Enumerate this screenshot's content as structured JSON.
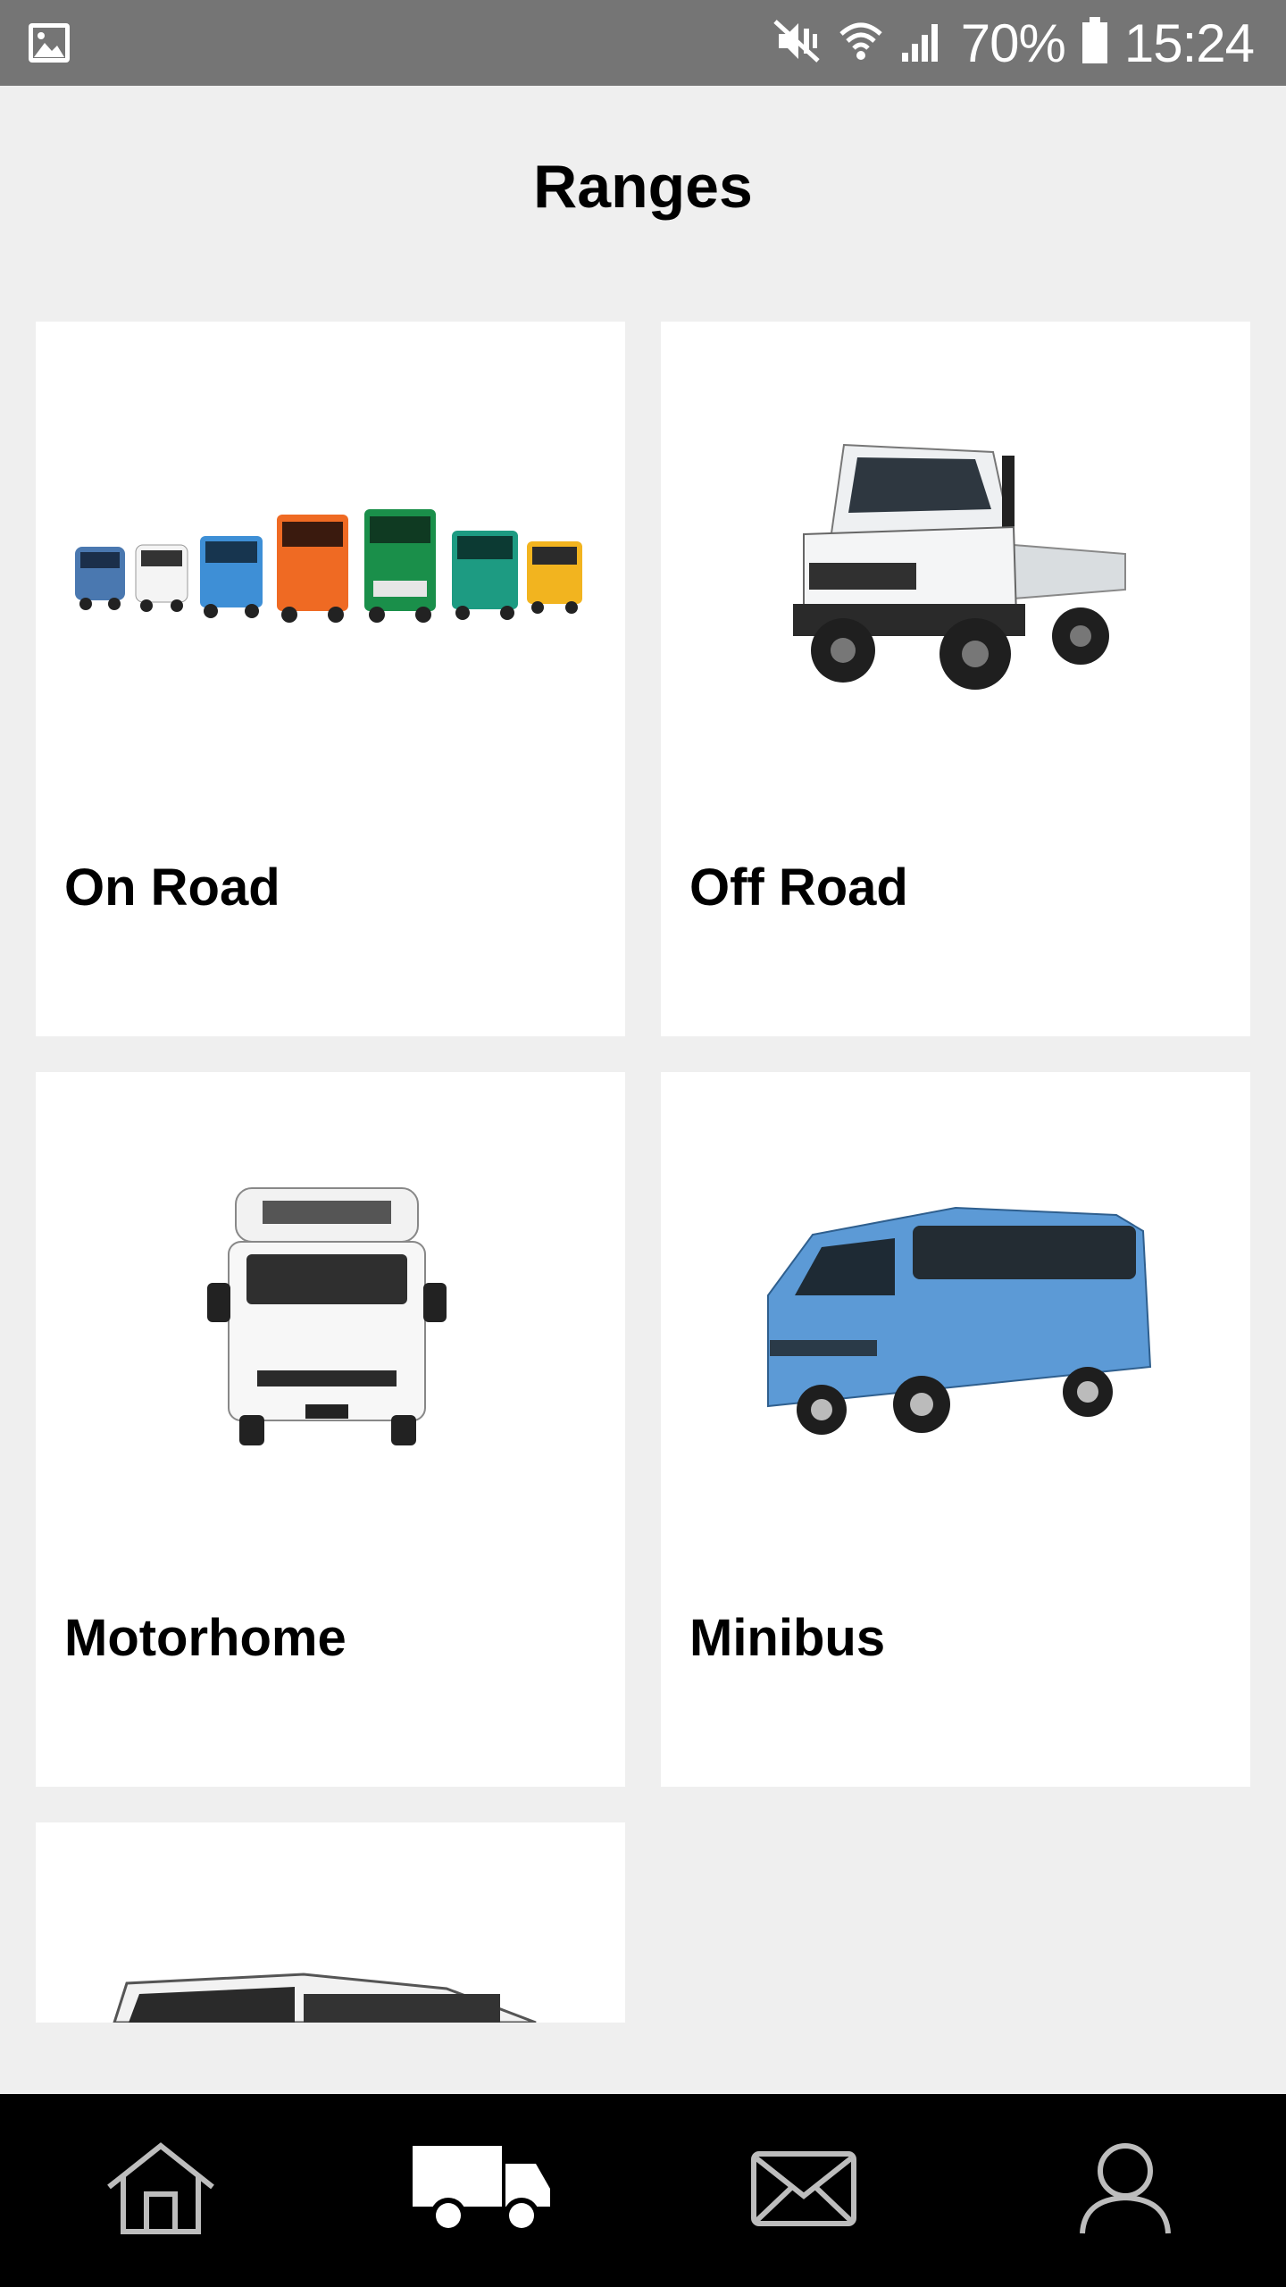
{
  "status_bar": {
    "battery_percent": "70%",
    "time": "15:24",
    "icons": [
      "image-icon",
      "mute-vibrate-icon",
      "wifi-icon",
      "signal-icon",
      "battery-icon"
    ]
  },
  "header": {
    "title": "Ranges"
  },
  "ranges": [
    {
      "label": "On Road"
    },
    {
      "label": "Off Road"
    },
    {
      "label": "Motorhome"
    },
    {
      "label": "Minibus"
    },
    {
      "label": ""
    }
  ],
  "bottom_nav": {
    "items": [
      {
        "icon": "home-icon",
        "active": false
      },
      {
        "icon": "truck-icon",
        "active": true
      },
      {
        "icon": "mail-icon",
        "active": false
      },
      {
        "icon": "user-icon",
        "active": false
      }
    ]
  },
  "colors": {
    "status_bar_bg": "#757575",
    "page_bg": "#efefef",
    "card_bg": "#ffffff",
    "nav_bg": "#000000"
  }
}
